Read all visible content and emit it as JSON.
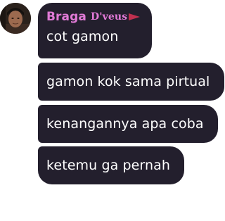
{
  "sender": {
    "name": "Braga",
    "tag": "D'veus"
  },
  "messages": [
    {
      "text": "cot gamon"
    },
    {
      "text": "gamon kok sama pirtual"
    },
    {
      "text": "kenangannya apa coba"
    },
    {
      "text": "ketemu ga pernah"
    }
  ],
  "colors": {
    "bubble": "#231f2d",
    "sender_name": "#e07ad6",
    "flag": "#c0304f"
  }
}
